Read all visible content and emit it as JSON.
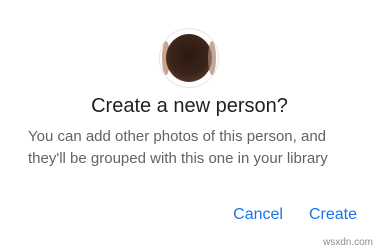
{
  "dialog": {
    "avatar": "person-photo",
    "title": "Create a new person?",
    "body": "You can add other photos of this person, and they'll be grouped with this one in your library",
    "cancel_label": "Cancel",
    "create_label": "Create",
    "accent_color": "#1a73e8"
  },
  "watermark": "wsxdn.com"
}
